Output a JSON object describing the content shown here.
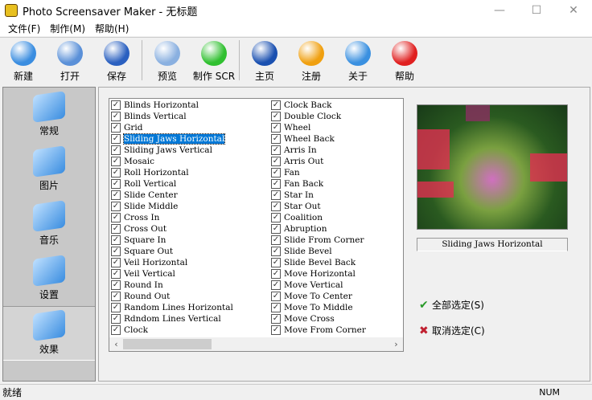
{
  "window": {
    "title": "Photo Screensaver Maker - 无标题",
    "min": "—",
    "max": "☐",
    "close": "✕"
  },
  "menu": [
    "文件(F)",
    "制作(M)",
    "帮助(H)"
  ],
  "toolbar": [
    {
      "label": "新建",
      "icon": "new-file-icon",
      "color": "#3a8de0"
    },
    {
      "label": "打开",
      "icon": "open-folder-icon",
      "color": "#5a90d8"
    },
    {
      "label": "保存",
      "icon": "save-disk-icon",
      "color": "#2a60c0"
    },
    {
      "label": "预览",
      "icon": "magnifier-icon",
      "color": "#8ab0e0"
    },
    {
      "label": "制作 SCR",
      "icon": "play-icon",
      "color": "#30c030"
    },
    {
      "label": "主页",
      "icon": "internet-explorer-icon",
      "color": "#1a50b0"
    },
    {
      "label": "注册",
      "icon": "orange-orb-icon",
      "color": "#f0a010"
    },
    {
      "label": "关于",
      "icon": "info-icon",
      "color": "#3a90e0"
    },
    {
      "label": "帮助",
      "icon": "red-cross-icon",
      "color": "#e02020"
    }
  ],
  "sidebar": [
    {
      "label": "常规",
      "icon": "general-folder-icon"
    },
    {
      "label": "图片",
      "icon": "pictures-folder-icon"
    },
    {
      "label": "音乐",
      "icon": "music-speaker-icon"
    },
    {
      "label": "设置",
      "icon": "settings-gear-icon"
    },
    {
      "label": "效果",
      "icon": "effects-paint-icon",
      "selected": true
    }
  ],
  "effects": {
    "col1": [
      "Blinds Horizontal",
      "Blinds Vertical",
      "Grid",
      "Sliding Jaws Horizontal",
      "Sliding Jaws Vertical",
      "Mosaic",
      "Roll Horizontal",
      "Roll Vertical",
      "Slide Center",
      "Slide Middle",
      "Cross In",
      "Cross Out",
      "Square In",
      "Square Out",
      "Veil Horizontal",
      "Veil Vertical",
      "Round In",
      "Round Out",
      "Random Lines Horizontal",
      "Rdndom Lines Vertical",
      "Clock"
    ],
    "col2": [
      "Clock Back",
      "Double Clock",
      "Wheel",
      "Wheel Back",
      "Arris In",
      "Arris Out",
      "Fan",
      "Fan Back",
      "Star In",
      "Star Out",
      "Coalition",
      "Abruption",
      "Slide From Corner",
      "Slide Bevel",
      "Slide Bevel Back",
      "Move Horizontal",
      "Move Vertical",
      "Move To Center",
      "Move To Middle",
      "Move Cross",
      "Move From Corner"
    ],
    "selected": "Sliding Jaws Horizontal",
    "all_checked": true
  },
  "preview": {
    "caption": "Sliding Jaws Horizontal"
  },
  "actions": {
    "select_all": "全部选定(S)",
    "deselect_all": "取消选定(C)"
  },
  "status": {
    "text": "就绪",
    "num": "NUM"
  }
}
